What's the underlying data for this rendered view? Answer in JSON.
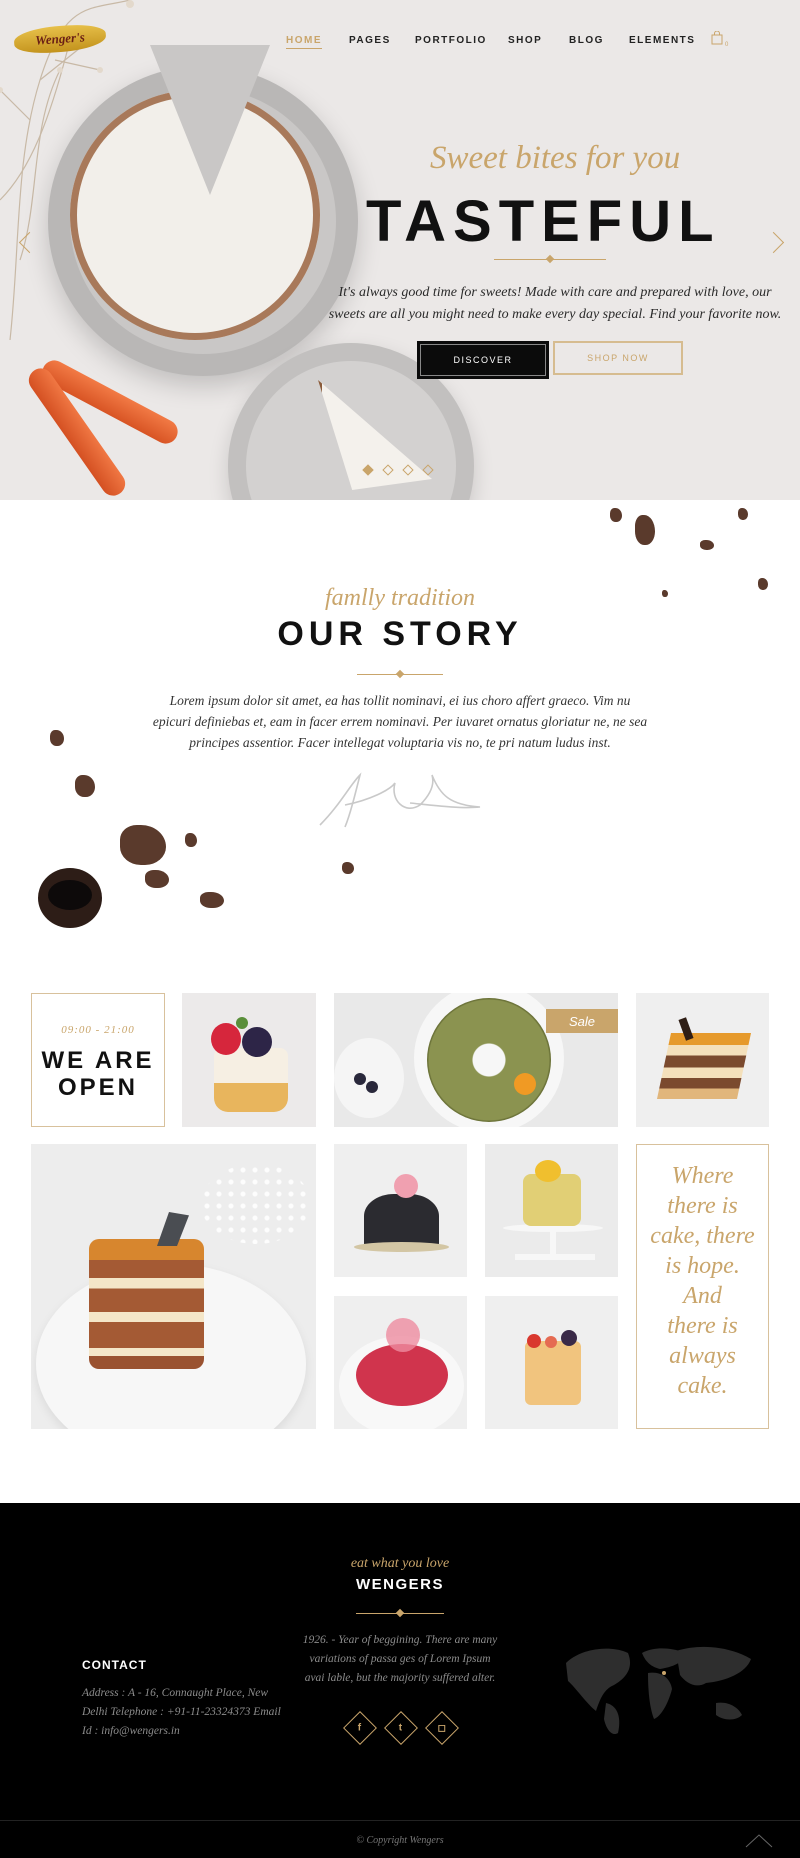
{
  "nav": {
    "logo": "Wenger's",
    "items": [
      "HOME",
      "PAGES",
      "PORTFOLIO",
      "SHOP",
      "BLOG",
      "ELEMENTS"
    ],
    "cart_count": "0"
  },
  "hero": {
    "subtitle": "Sweet bites for you",
    "title": "TASTEFUL",
    "text": "It's always good time for sweets! Made with care and prepared with love, our sweets are all you might need to make every day special. Find your favorite now.",
    "btn_primary": "DISCOVER",
    "btn_secondary": "SHOP NOW"
  },
  "story": {
    "subtitle": "famlly tradition",
    "title": "OUR STORY",
    "text": "Lorem ipsum dolor sit amet, ea has tollit nominavi, ei ius choro affert graeco. Vim nu epicuri definiebas et, eam in facer errem nominavi. Per iuvaret ornatus gloriatur ne, ne sea principes assentior. Facer intellegat voluptaria vis no, te pri natum ludus inst."
  },
  "gallery": {
    "open_time": "09:00 - 21:00",
    "open_title_1": "WE ARE",
    "open_title_2": "OPEN",
    "sale_badge": "Sale",
    "quote": [
      "Where",
      "there is",
      "cake, there",
      "is hope.",
      "And",
      "there is",
      "always",
      "cake."
    ]
  },
  "footer": {
    "subtitle": "eat what you love",
    "title": "WENGERS",
    "about": "1926. - Year of beggining. There are many variations of passa ges of Lorem Ipsum avai lable, but the majority suffered alter.",
    "contact_title": "CONTACT",
    "contact_text": "Address : A - 16, Connaught Place, New Delhi Telephone : +91-11-23324373 Email Id : info@wengers.in",
    "copyright": "© Copyright Wengers"
  },
  "colors": {
    "accent": "#c9a56b",
    "dark": "#000000"
  },
  "icons": [
    "cart-icon",
    "arrow-left-icon",
    "arrow-right-icon",
    "facebook-icon",
    "twitter-icon",
    "instagram-icon",
    "arrow-up-icon"
  ]
}
